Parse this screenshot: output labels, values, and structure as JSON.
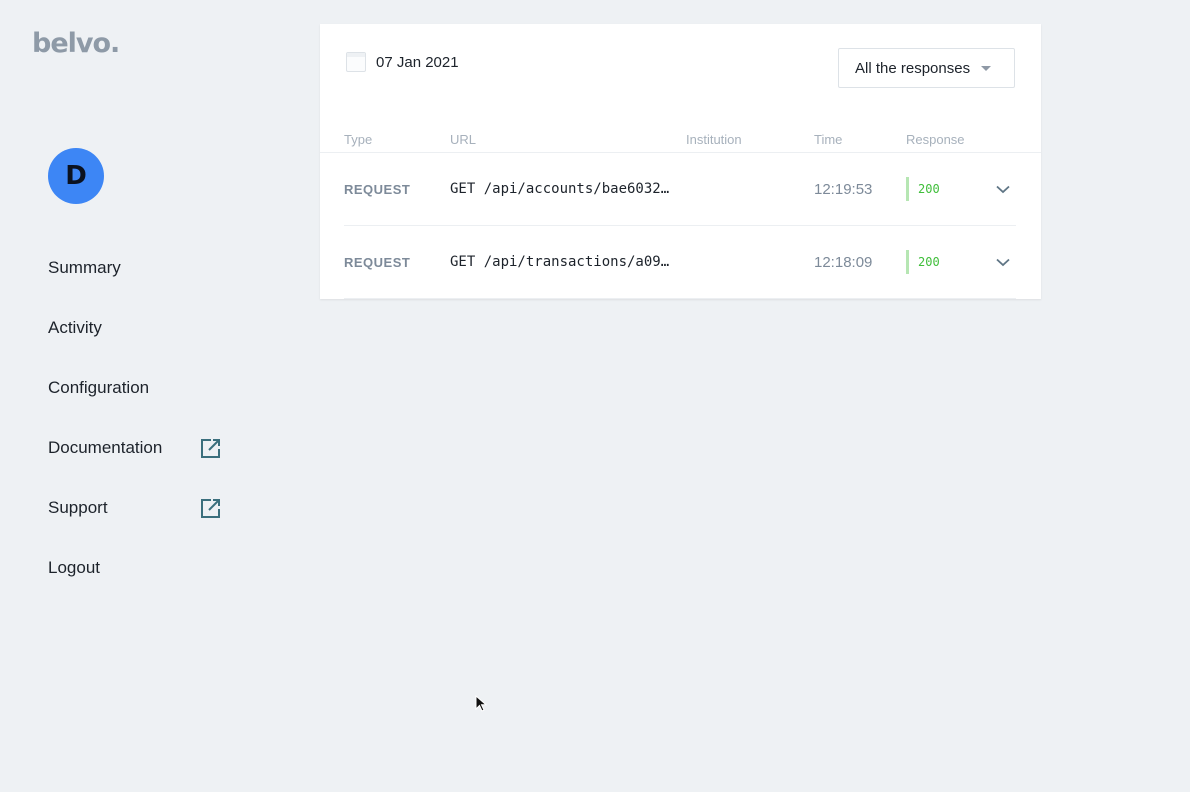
{
  "brand": {
    "logo": "belvo."
  },
  "user": {
    "avatar_initial": "D"
  },
  "sidebar": {
    "items": [
      {
        "label": "Summary",
        "external": false
      },
      {
        "label": "Activity",
        "external": false
      },
      {
        "label": "Configuration",
        "external": false
      },
      {
        "label": "Documentation",
        "external": true
      },
      {
        "label": "Support",
        "external": true
      },
      {
        "label": "Logout",
        "external": false
      }
    ]
  },
  "activity": {
    "date": "07 Jan 2021",
    "filter_label": "All the responses",
    "columns": {
      "type": "Type",
      "url": "URL",
      "institution": "Institution",
      "time": "Time",
      "response": "Response"
    },
    "rows": [
      {
        "type": "REQUEST",
        "url": "GET /api/accounts/bae6032…",
        "institution": "",
        "time": "12:19:53",
        "response": "200"
      },
      {
        "type": "REQUEST",
        "url": "GET /api/transactions/a09…",
        "institution": "",
        "time": "12:18:09",
        "response": "200"
      }
    ]
  },
  "colors": {
    "avatar": "#3d86f5",
    "success": "#3fbe3a",
    "success_bar": "#b6e6b3",
    "background": "#eef1f4"
  },
  "icons": {
    "external_link": "external-link-icon",
    "calendar": "calendar-icon",
    "dropdown": "caret-down-icon",
    "expand": "chevron-down-icon"
  }
}
